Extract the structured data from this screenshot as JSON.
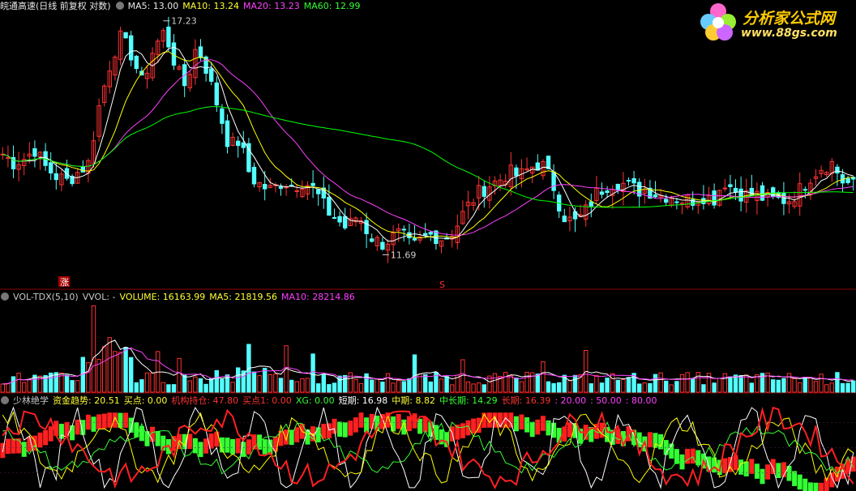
{
  "header_main": {
    "title": "皖通高速(日线 前复权 对数)",
    "ma5": "MA5: 13.00",
    "ma10": "MA10: 13.24",
    "ma20": "MA20: 13.23",
    "ma60": "MA60: 12.99"
  },
  "header_vol": {
    "title": "VOL-TDX(5,10)",
    "vvol": "VVOL: -",
    "volume": "VOLUME: 16163.99",
    "ma5": "MA5: 21819.56",
    "ma10": "MA10: 28214.86"
  },
  "header_ind": {
    "title": "少林绝学",
    "zjqs": "资金趋势: 20.51",
    "mdian": "买点: 0.00",
    "jgcc": "机构持仓: 47.80",
    "mdian1": "买点1: 0.00",
    "xg": "XG: 0.00",
    "dq": "短期: 16.98",
    "zq": "中期: 8.82",
    "zcq": "中长期: 14.29",
    "cq": "长期: 16.39",
    "l20": ": 20.00",
    "l50": ": 50.00",
    "l80": ": 80.00"
  },
  "logo": {
    "line1": "分析家公式网",
    "line2": "www.88gs.com"
  },
  "colors": {
    "up": "#ff3232",
    "down": "#54ffff",
    "ma5": "#ffffff",
    "ma10": "#ffff00",
    "ma20": "#ff40ff",
    "ma60": "#00ff00",
    "grid": "#8b0000"
  },
  "chart_data": {
    "type": "candlestick",
    "y_scale": "log",
    "annotations": {
      "high_label": "17.23",
      "low_label": "11.69",
      "mark_zhang": "涨",
      "mark_s": "S"
    },
    "price": {
      "close_path": [
        13.8,
        13.6,
        13.7,
        13.9,
        13.5,
        13.3,
        13.2,
        13.4,
        13.6,
        15.0,
        16.0,
        16.8,
        16.2,
        15.5,
        16.4,
        16.9,
        16.0,
        15.4,
        16.5,
        15.8,
        14.9,
        14.0,
        14.1,
        13.3,
        13.1,
        13.0,
        13.2,
        13.1,
        13.2,
        13.0,
        12.6,
        12.4,
        12.2,
        12.5,
        12.1,
        11.9,
        12.0,
        12.1,
        11.8,
        12.0,
        12.1,
        12.0,
        12.2,
        12.6,
        12.9,
        13.1,
        13.2,
        13.4,
        13.3,
        13.5,
        13.6,
        13.2,
        12.5,
        12.3,
        12.5,
        12.9,
        13.1,
        13.2,
        13.1,
        13.0,
        13.0,
        12.9,
        12.9,
        12.8,
        12.8,
        12.9,
        12.8,
        13.2,
        13.0,
        12.9,
        12.9,
        12.8,
        12.8,
        12.8,
        13.0,
        13.3,
        13.5,
        13.6,
        13.2,
        13.1
      ],
      "high": 17.23,
      "low": 11.69
    },
    "ma": {
      "MA5": 13.0,
      "MA10": 13.24,
      "MA20": 13.23,
      "MA60": 12.99
    },
    "volume": {
      "VOLUME": 16163.99,
      "MA5": 21819.56,
      "MA10": 28214.86
    },
    "indicator": {
      "资金趋势": 20.51,
      "买点": 0.0,
      "机构持仓": 47.8,
      "买点1": 0.0,
      "XG": 0.0,
      "短期": 16.98,
      "中期": 8.82,
      "中长期": 14.29,
      "长期": 16.39,
      "levels": [
        20.0,
        50.0,
        80.0
      ]
    }
  }
}
